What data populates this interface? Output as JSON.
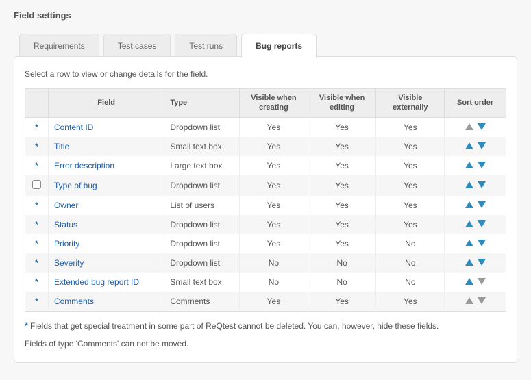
{
  "pageTitle": "Field settings",
  "tabs": [
    {
      "label": "Requirements",
      "active": false
    },
    {
      "label": "Test cases",
      "active": false
    },
    {
      "label": "Test runs",
      "active": false
    },
    {
      "label": "Bug reports",
      "active": true
    }
  ],
  "instruction": "Select a row to view or change details for the field.",
  "columns": {
    "marker": "",
    "field": "Field",
    "type": "Type",
    "visCreating": "Visible when creating",
    "visEditing": "Visible when editing",
    "visExternal": "Visible externally",
    "sort": "Sort order"
  },
  "rows": [
    {
      "special": true,
      "field": "Content ID",
      "type": "Dropdown list",
      "visCreating": "Yes",
      "visEditing": "Yes",
      "visExternal": "Yes",
      "upEnabled": false,
      "downEnabled": true
    },
    {
      "special": true,
      "field": "Title",
      "type": "Small text box",
      "visCreating": "Yes",
      "visEditing": "Yes",
      "visExternal": "Yes",
      "upEnabled": true,
      "downEnabled": true
    },
    {
      "special": true,
      "field": "Error description",
      "type": "Large text box",
      "visCreating": "Yes",
      "visEditing": "Yes",
      "visExternal": "Yes",
      "upEnabled": true,
      "downEnabled": true
    },
    {
      "special": false,
      "field": "Type of bug",
      "type": "Dropdown list",
      "visCreating": "Yes",
      "visEditing": "Yes",
      "visExternal": "Yes",
      "upEnabled": true,
      "downEnabled": true
    },
    {
      "special": true,
      "field": "Owner",
      "type": "List of users",
      "visCreating": "Yes",
      "visEditing": "Yes",
      "visExternal": "Yes",
      "upEnabled": true,
      "downEnabled": true
    },
    {
      "special": true,
      "field": "Status",
      "type": "Dropdown list",
      "visCreating": "Yes",
      "visEditing": "Yes",
      "visExternal": "Yes",
      "upEnabled": true,
      "downEnabled": true
    },
    {
      "special": true,
      "field": "Priority",
      "type": "Dropdown list",
      "visCreating": "Yes",
      "visEditing": "Yes",
      "visExternal": "No",
      "upEnabled": true,
      "downEnabled": true
    },
    {
      "special": true,
      "field": "Severity",
      "type": "Dropdown list",
      "visCreating": "No",
      "visEditing": "No",
      "visExternal": "No",
      "upEnabled": true,
      "downEnabled": true
    },
    {
      "special": true,
      "field": "Extended bug report ID",
      "type": "Small text box",
      "visCreating": "No",
      "visEditing": "No",
      "visExternal": "No",
      "upEnabled": true,
      "downEnabled": false
    },
    {
      "special": true,
      "field": "Comments",
      "type": "Comments",
      "visCreating": "Yes",
      "visEditing": "Yes",
      "visExternal": "Yes",
      "upEnabled": false,
      "downEnabled": false
    }
  ],
  "footnoteStar": "*",
  "footnote1": " Fields that get special treatment in some part of ReQtest cannot be deleted. You can, however, hide these fields.",
  "footnote2": "Fields of type 'Comments' can not be moved."
}
